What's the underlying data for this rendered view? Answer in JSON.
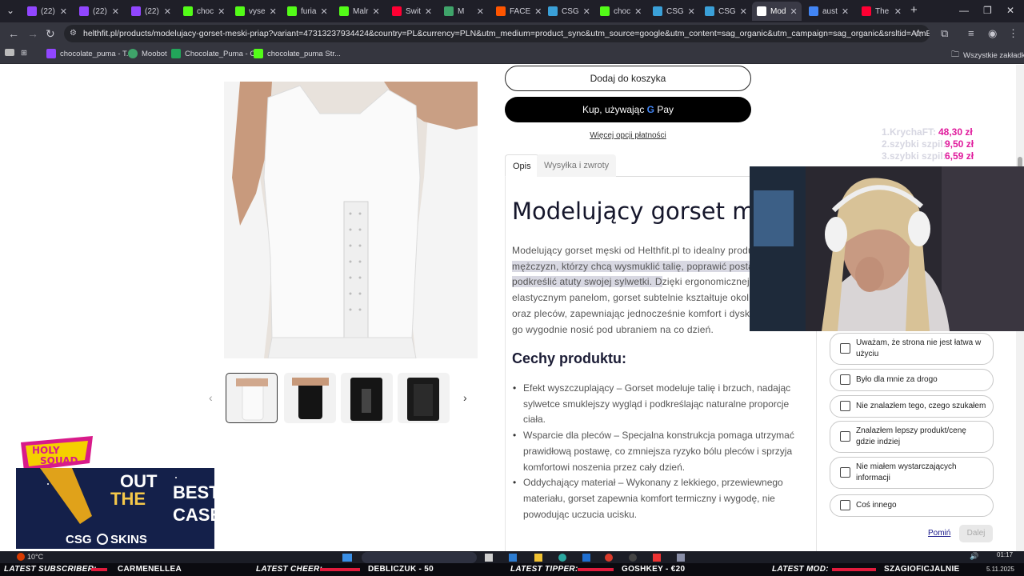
{
  "browser": {
    "tabs": [
      {
        "label": "(22)",
        "color": "#9146ff"
      },
      {
        "label": "(22)",
        "color": "#9146ff"
      },
      {
        "label": "(22)",
        "color": "#9146ff"
      },
      {
        "label": "choc",
        "color": "#53fc18"
      },
      {
        "label": "vyse",
        "color": "#53fc18"
      },
      {
        "label": "furia",
        "color": "#53fc18"
      },
      {
        "label": "Malr",
        "color": "#53fc18"
      },
      {
        "label": "Swit",
        "color": "#ff0033"
      },
      {
        "label": "M",
        "color": "#3fa46a"
      },
      {
        "label": "FACE",
        "color": "#ff5500"
      },
      {
        "label": "CSG",
        "color": "#3aa0d8"
      },
      {
        "label": "choc",
        "color": "#53fc18"
      },
      {
        "label": "CSG",
        "color": "#3aa0d8"
      },
      {
        "label": "CSG",
        "color": "#3aa0d8"
      },
      {
        "label": "Mod",
        "color": "#ffffff"
      },
      {
        "label": "aust",
        "color": "#4285f4"
      },
      {
        "label": "The",
        "color": "#ff0033"
      }
    ],
    "url": "helthfit.pl/products/modelujacy-gorset-meski-priap?variant=47313237934424&country=PL&currency=PLN&utm_medium=product_sync&utm_source=google&utm_content=sag_organic&utm_campaign=sag_organic&srsltid=AfmBOorijWgXISYBSL...",
    "bookmarks": [
      "chocolate_puma - T...",
      "Moobot",
      "Chocolate_Puma - C...",
      "chocolate_puma Str..."
    ],
    "all_bookmarks": "Wszystkie zakładki"
  },
  "product": {
    "add_to_cart": "Dodaj do koszyka",
    "buy_with": "Kup, używając",
    "gpay": "Pay",
    "more_payment": "Więcej opcji płatności",
    "tabs": [
      "Opis",
      "Wysyłka i zwroty"
    ],
    "title": "Modelujący gorset mę",
    "description": {
      "line1": "Modelujący gorset męski od Helthfit.pl to idealny produk",
      "line2": "mężczyzn, którzy chcą wysmuklić talię, poprawić postav",
      "line3a": "podkreślić atuty swojej sylwetki. D",
      "line3b": "zięki ergonomicznej k",
      "line4": "elastycznym panelom, gorset subtelnie kształtuje okolic",
      "line5": "oraz pleców, zapewniając jednocześnie komfort i dyskre",
      "line6": "go wygodnie nosić pod ubraniem na co dzień."
    },
    "features_title": "Cechy produktu:",
    "features": [
      {
        "line1": "Efekt wyszczuplający – Gorset modeluje talię i brzuch, nadając",
        "line2": "sylwetce smuklejszy wygląd i podkreślając naturalne proporcje",
        "line3": "ciała."
      },
      {
        "line1": "Wsparcie dla pleców – Specjalna konstrukcja pomaga utrzymać",
        "line2": "prawidłową postawę, co zmniejsza ryzyko bólu pleców i sprzyja",
        "line3": "komfortowi noszenia przez cały dzień."
      },
      {
        "line1": "Oddychający materiał – Wykonany z lekkiego, przewiewnego",
        "line2": "materiału, gorset zapewnia komfort termiczny i wygodę, nie",
        "line3": "powodując uczucia ucisku."
      }
    ]
  },
  "survey": {
    "options": [
      "Uważam, że strona nie jest łatwa w użyciu",
      "Było dla mnie za drogo",
      "Nie znalazłem tego, czego szukałem",
      "Znalazłem lepszy produkt/cenę gdzie indziej",
      "Nie miałem wystarczających informacji",
      "Coś innego"
    ],
    "skip": "Pomiń",
    "next": "Dalej"
  },
  "stream": {
    "tippers": [
      {
        "rank": "1.KrychaFT:",
        "amount": "48,30 zł"
      },
      {
        "rank": "2.szybki szpil:",
        "amount": "9,50 zł"
      },
      {
        "rank": "3.szybki szpil:",
        "amount": "6,59 zł"
      }
    ],
    "logo_text": "HOLY SQUAD",
    "banner": {
      "line1": "OUT",
      "line2": "THE",
      "line3": "BEST",
      "line4": "CASE",
      "brand": "CSG",
      "brand_suffix": "SKINS"
    },
    "ticker": [
      {
        "label": "LATEST SUBSCRIBER:",
        "value": "CARMENELLEA"
      },
      {
        "label": "LATEST CHEER:",
        "value": "DEBLICZUK - 50"
      },
      {
        "label": "LATEST TIPPER:",
        "value": "GOSHKEY - €20"
      },
      {
        "label": "LATEST MOD:",
        "value": "SZAGIOFICJALNIE"
      }
    ]
  },
  "taskbar": {
    "weather": "10°C",
    "time": "01:17",
    "date": "5.11.2025"
  }
}
